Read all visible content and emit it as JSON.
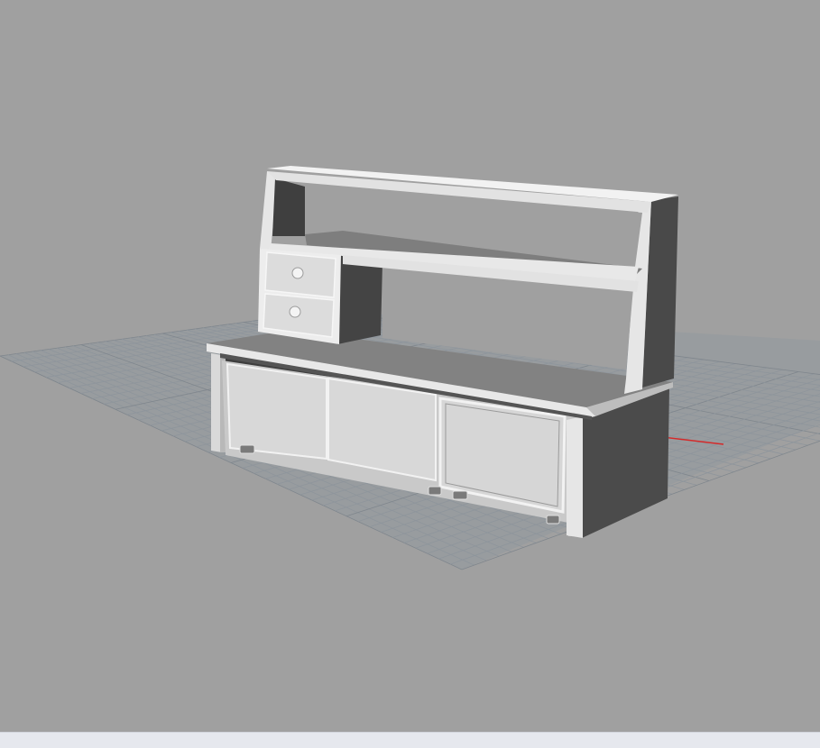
{
  "viewport": {
    "background_color": "#a0a0a0",
    "grid_color": "#8e959c",
    "grid_major_color": "#7f868d",
    "x_axis_color": "#d42a2a",
    "y_axis_color": "#2eaa2e",
    "model_highlight_color": "#eeeeee",
    "model_midtone_color": "#d6d6d6",
    "model_shadow_color": "#4a4a4a"
  },
  "status_strip": {
    "background_color": "#e6e8ee"
  }
}
